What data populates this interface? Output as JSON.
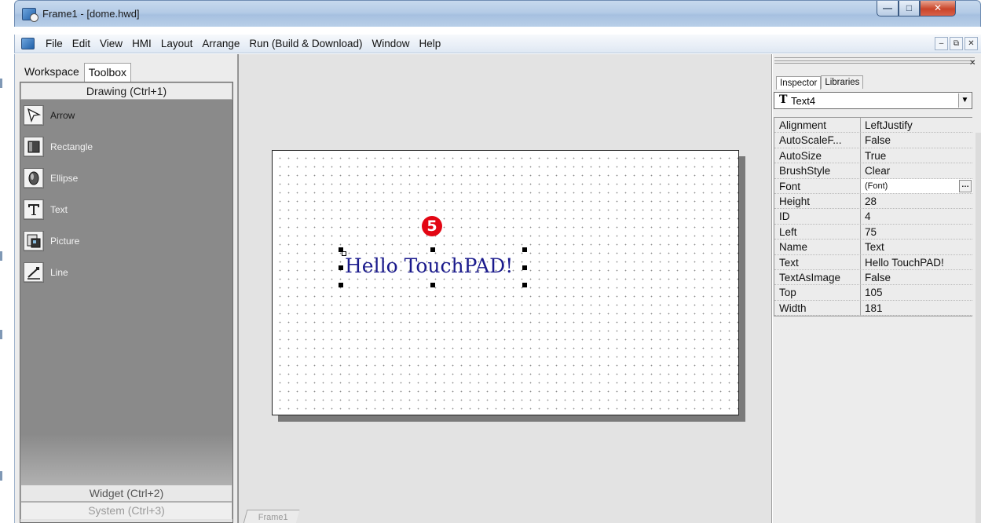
{
  "window": {
    "title": "Frame1 - [dome.hwd]"
  },
  "menu": {
    "items": [
      "File",
      "Edit",
      "View",
      "HMI",
      "Layout",
      "Arrange",
      "Run (Build & Download)",
      "Window",
      "Help"
    ]
  },
  "left_panel": {
    "tabs": [
      "Workspace",
      "Toolbox"
    ],
    "active_tab": "Toolbox",
    "categories": {
      "drawing": "Drawing (Ctrl+1)",
      "widget": "Widget (Ctrl+2)",
      "system": "System (Ctrl+3)"
    },
    "tools": [
      {
        "label": "Arrow",
        "icon": "arrow-cursor-icon",
        "selected": true
      },
      {
        "label": "Rectangle",
        "icon": "rectangle-icon"
      },
      {
        "label": "Ellipse",
        "icon": "ellipse-icon"
      },
      {
        "label": "Text",
        "icon": "text-icon"
      },
      {
        "label": "Picture",
        "icon": "picture-icon"
      },
      {
        "label": "Line",
        "icon": "line-icon"
      }
    ]
  },
  "canvas": {
    "text": "Hello TouchPAD!",
    "callout": "5",
    "frame_tab": "Frame1"
  },
  "inspector": {
    "tabs": [
      "Inspector",
      "Libraries"
    ],
    "active_tab": "Inspector",
    "object": "Text4",
    "properties": [
      {
        "name": "Alignment",
        "value": "LeftJustify"
      },
      {
        "name": "AutoScaleF...",
        "value": "False"
      },
      {
        "name": "AutoSize",
        "value": "True"
      },
      {
        "name": "BrushStyle",
        "value": "Clear"
      },
      {
        "name": "Font",
        "value": "(Font)",
        "editing": true
      },
      {
        "name": "Height",
        "value": "28"
      },
      {
        "name": "ID",
        "value": "4"
      },
      {
        "name": "Left",
        "value": "75"
      },
      {
        "name": "Name",
        "value": "Text"
      },
      {
        "name": "Text",
        "value": "Hello TouchPAD!"
      },
      {
        "name": "TextAsImage",
        "value": "False"
      },
      {
        "name": "Top",
        "value": "105"
      },
      {
        "name": "Width",
        "value": "181"
      }
    ]
  },
  "colors": {
    "title_bar": "#b4cbe6",
    "canvas_text": "#1a1a8c",
    "callout": "#e30613",
    "toolbox_bg": "#8a8a8a"
  }
}
